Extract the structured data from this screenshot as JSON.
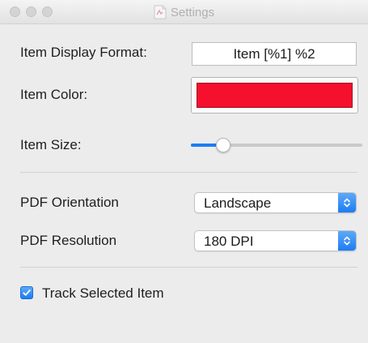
{
  "window": {
    "title": "Settings",
    "title_icon": "document-icon"
  },
  "colors": {
    "accent": "#1d7cf4",
    "item_color": "#f5102d"
  },
  "item_display_format": {
    "label": "Item Display Format:",
    "value": "Item [%1] %2"
  },
  "item_color": {
    "label": "Item Color:"
  },
  "item_size": {
    "label": "Item Size:",
    "slider_fraction": 0.16
  },
  "pdf_orientation": {
    "label": "PDF Orientation",
    "selected": "Landscape"
  },
  "pdf_resolution": {
    "label": "PDF Resolution",
    "selected": "180 DPI"
  },
  "track_selected": {
    "label": "Track Selected Item",
    "checked": true
  }
}
